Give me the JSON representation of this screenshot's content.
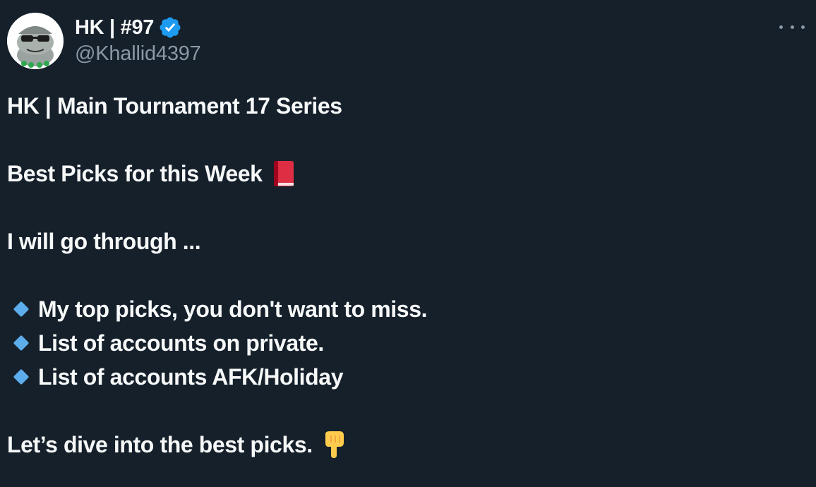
{
  "author": {
    "display_name": "HK | #97",
    "handle": "@Khallid4397",
    "verified": true,
    "avatar": "cartoon-frog-avatar-icon"
  },
  "colors": {
    "background": "#15202b",
    "text": "#f7f9f9",
    "secondary_text": "#8b98a5",
    "verified_badge": "#1d9bf0",
    "bullet_diamond": "#5dadec"
  },
  "tweet": {
    "title": "HK | Main Tournament 17 Series",
    "subtitle": "Best Picks for this Week",
    "subtitle_emoji": "closed-book-icon",
    "intro": "I will go through ...",
    "bullet_icon": "small-blue-diamond-icon",
    "bullets": [
      "My top picks, you don't want to miss.",
      "List of accounts on private.",
      "List of accounts AFK/Holiday"
    ],
    "closing": "Let’s dive into the best picks.",
    "closing_emoji": "backhand-index-pointing-down-icon"
  },
  "menu": {
    "more_icon": "more-options-icon"
  }
}
